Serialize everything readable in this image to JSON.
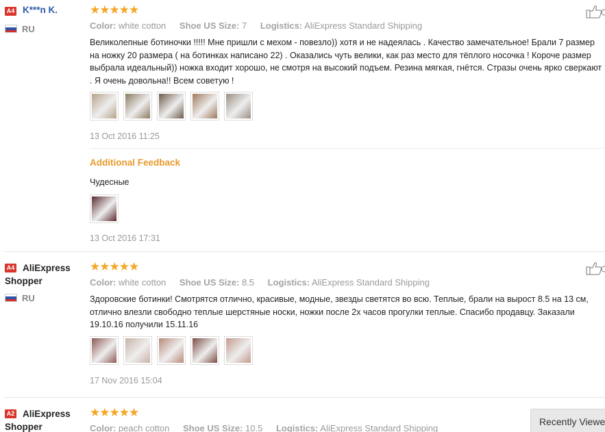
{
  "reviews": [
    {
      "badge": "A4",
      "user": "K***n K.",
      "country": "RU",
      "stars": "★★★★★",
      "color_label": "Color:",
      "color_value": "white cotton",
      "size_label": "Shoe US Size:",
      "size_value": "7",
      "logistics_label": "Logistics:",
      "logistics_value": "AliExpress Standard Shipping",
      "text": "Великолепные ботиночки !!!!! Мне пришли с мехом - повезло)) хотя и не надеялась . Качество замечательное! Брали 7 размер на ножку 20 размера ( на ботинках написано 22) . Оказались чуть велики, как раз место для тёплого носочка ! Короче размер выбрала идеальный)) ножка входит хорошо, не смотря на высокий подъем. Резина мягкая, гнётся. Стразы очень ярко сверкают . Я очень довольна!! Всем советую !",
      "date": "13 Oct 2016 11:25",
      "additional_label": "Additional Feedback",
      "additional_text": "Чудесные",
      "additional_date": "13 Oct 2016 17:31",
      "photo_colors": [
        "#b7a48a",
        "#8c7a62",
        "#6e5b4b",
        "#a0785c",
        "#9a8e84"
      ],
      "additional_photo_colors": [
        "#5b2a2f"
      ]
    },
    {
      "badge": "A4",
      "user": "AliExpress Shopper",
      "country": "RU",
      "stars": "★★★★★",
      "color_label": "Color:",
      "color_value": "white cotton",
      "size_label": "Shoe US Size:",
      "size_value": "8.5",
      "logistics_label": "Logistics:",
      "logistics_value": "AliExpress Standard Shipping",
      "text": "Здоровские ботинки! Смотрятся отлично, красивые, модные, звезды светятся во всю. Теплые, брали на вырост 8.5 на 13 см, отлично влезли свободно теплые шерстяные носки, ножки после 2х часов прогулки теплые. Спасибо продавцу. Заказали 19.10.16 получили 15.11.16",
      "date": "17 Nov 2016 15:04",
      "photo_colors": [
        "#8e5a55",
        "#c9b3a8",
        "#b98a7a",
        "#7b4d45",
        "#c49a8e"
      ]
    },
    {
      "badge": "A2",
      "user": "AliExpress Shopper",
      "stars": "★★★★★",
      "color_label": "Color:",
      "color_value": "peach cotton",
      "size_label": "Shoe US Size:",
      "size_value": "10.5",
      "logistics_label": "Logistics:",
      "logistics_value": "AliExpress Standard Shipping"
    }
  ],
  "recently_viewed": "Recently Viewed",
  "colors": {
    "star": "#f5a623",
    "badge": "#d9352b",
    "accent": "#e89a2d",
    "link": "#2e5aa8"
  }
}
